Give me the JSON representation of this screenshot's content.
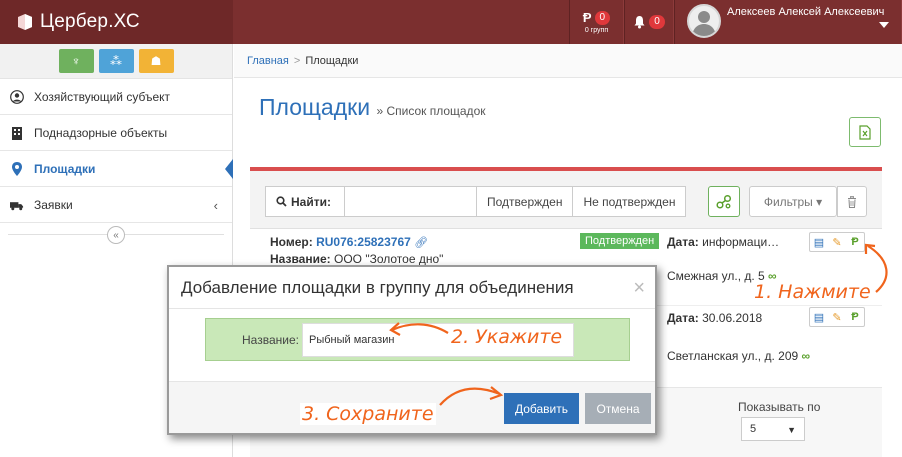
{
  "app": {
    "title": "Цербер.ХС"
  },
  "topbar": {
    "groups_count": "0",
    "groups_label": "0 групп",
    "notifications_count": "0",
    "user_name": "Алексеев Алексей Алексеевич"
  },
  "sidebar": {
    "items": [
      {
        "label": "Хозяйствующий субъект",
        "icon": "person-circle-icon"
      },
      {
        "label": "Поднадзорные объекты",
        "icon": "building-icon"
      },
      {
        "label": "Площадки",
        "icon": "map-pin-icon"
      },
      {
        "label": "Заявки",
        "icon": "truck-icon",
        "chevron": "‹"
      }
    ],
    "collapse_glyph": "«"
  },
  "breadcrumb": {
    "home": "Главная",
    "sep": ">",
    "current": "Площадки"
  },
  "page": {
    "title": "Площадки",
    "subtitle": "» Список площадок"
  },
  "toolbar": {
    "search_label": "Найти:",
    "search_value": "",
    "filter_confirmed": "Подтвержден",
    "filter_unconfirmed": "Не подтвержден",
    "filters_label": "Фильтры ▾"
  },
  "rows": [
    {
      "number_label": "Номер:",
      "number": "RU076:25823767",
      "name_label": "Название:",
      "name": "ООО \"Золотое дно\"",
      "status": "Подтвержден",
      "date_label": "Дата:",
      "date": "информаци…",
      "address": "Смежная ул., д. 5"
    },
    {
      "date_label": "Дата:",
      "date": "30.06.2018",
      "address": "Светланская ул., д. 209"
    }
  ],
  "pager": {
    "label": "Показывать по",
    "value": "5"
  },
  "modal": {
    "title": "Добавление площадки в группу для объединения",
    "close": "×",
    "field_label": "Название:",
    "field_value": "Рыбный магазин",
    "add_label": "Добавить",
    "cancel_label": "Отмена"
  },
  "annotations": {
    "step1": "1. Нажмите",
    "step2": "2. Укажите",
    "step3": "3. Сохраните",
    "color": "#f0641c"
  },
  "colors": {
    "topbar": "#7b2f2f",
    "accent": "#2e70b8",
    "success": "#5cb85c",
    "danger": "#d94e4e"
  }
}
